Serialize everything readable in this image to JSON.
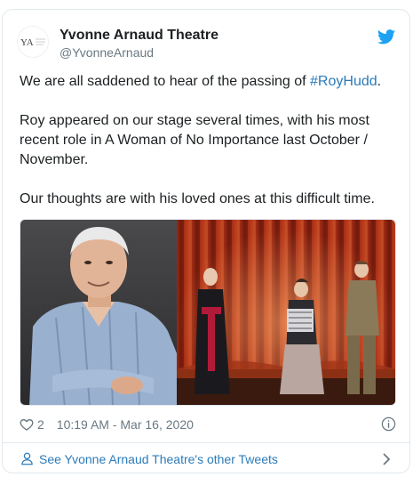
{
  "author": {
    "name": "Yvonne Arnaud Theatre",
    "handle": "@YvonneArnaud",
    "avatar_letters": "YA"
  },
  "tweet": {
    "line1_before": "We are all saddened to hear of the passing of ",
    "hashtag": "#RoyHudd",
    "line1_after": ".",
    "paragraph2": "Roy appeared on our stage several times, with his most recent role in A Woman of No Importance last October / November.",
    "paragraph3": "Our thoughts are with his loved ones at this difficult time."
  },
  "meta": {
    "likes": "2",
    "timestamp": "10:19 AM - Mar 16, 2020"
  },
  "footer": {
    "label": "See Yvonne Arnaud Theatre's other Tweets"
  },
  "icons": {
    "brand": "twitter-bird-icon",
    "like": "heart-icon",
    "info": "info-icon",
    "profile": "user-icon",
    "more": "chevron-right-icon"
  },
  "colors": {
    "link": "#2b7bb9",
    "twitter_blue": "#1da1f2",
    "muted": "#697882",
    "text": "#1c2022",
    "border": "#e1e8ed"
  }
}
